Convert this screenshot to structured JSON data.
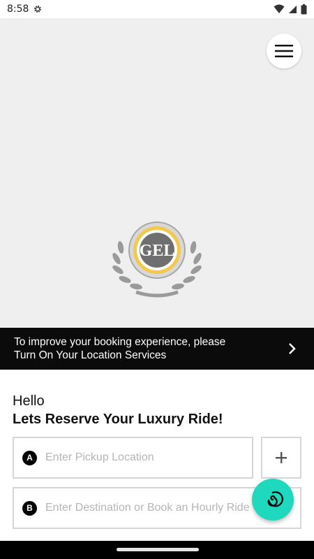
{
  "status_bar": {
    "time": "8:58",
    "icons": [
      "settings-gear-icon",
      "wifi-icon",
      "cell-signal-icon",
      "battery-icon"
    ]
  },
  "map": {
    "menu_icon": "hamburger-menu-icon",
    "logo": {
      "text": "GEL",
      "ring_color": "#f2c94c"
    }
  },
  "location_banner": {
    "line1": "To improve your booking experience, please",
    "line2": "Turn On Your Location Services",
    "icon": "chevron-right-icon"
  },
  "booking": {
    "greeting": "Hello",
    "tagline": "Lets Reserve Your Luxury Ride!",
    "pickup": {
      "badge": "A",
      "placeholder": "Enter Pickup Location",
      "value": ""
    },
    "add_stop_icon": "plus-icon",
    "destination": {
      "badge": "B",
      "placeholder": "Enter Destination or Book an Hourly Ride",
      "value": ""
    }
  },
  "fab": {
    "icon": "spiral-icon",
    "color": "#1fd9bf"
  }
}
